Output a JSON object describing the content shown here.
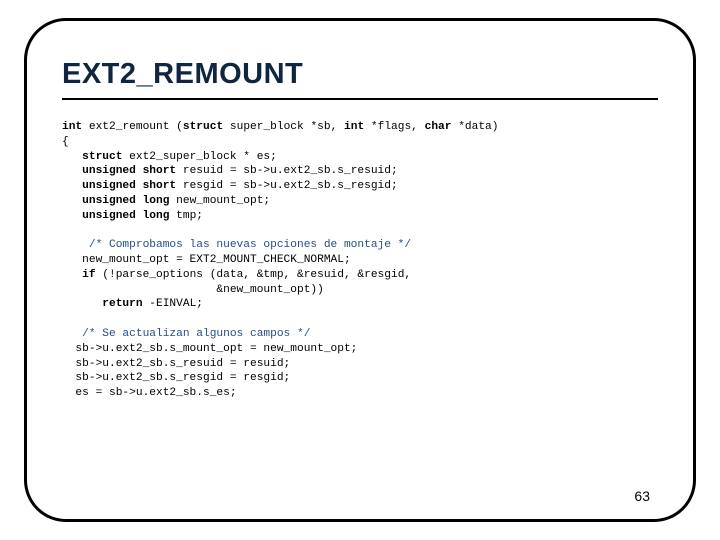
{
  "slide": {
    "title": "EXT2_REMOUNT",
    "page_number": "63",
    "code": {
      "sig_pre": "int",
      "sig_mid1": " ext2_remount (",
      "sig_kw2": "struct",
      "sig_mid2": " super_block *sb, ",
      "sig_kw3": "int",
      "sig_mid3": " *flags, ",
      "sig_kw4": "char",
      "sig_mid4": " *data)",
      "brace_open": "{",
      "l1_kw": "   struct",
      "l1_rest": " ext2_super_block * es;",
      "l2_kw": "   unsigned short",
      "l2_rest": " resuid = sb->u.ext2_sb.s_resuid;",
      "l3_kw": "   unsigned short",
      "l3_rest": " resgid = sb->u.ext2_sb.s_resgid;",
      "l4_kw": "   unsigned long",
      "l4_rest": " new_mount_opt;",
      "l5_kw": "   unsigned long",
      "l5_rest": " tmp;",
      "blank1": " ",
      "c1": "    /* Comprobamos las nuevas opciones de montaje */",
      "l6": "   new_mount_opt = EXT2_MOUNT_CHECK_NORMAL;",
      "l7_kw": "   if",
      "l7_rest": " (!parse_options (data, &tmp, &resuid, &resgid,",
      "l8": "                       &new_mount_opt))",
      "l9_kw": "      return",
      "l9_rest": " -EINVAL;",
      "blank2": " ",
      "c2": "   /* Se actualizan algunos campos */",
      "l10": "  sb->u.ext2_sb.s_mount_opt = new_mount_opt;",
      "l11": "  sb->u.ext2_sb.s_resuid = resuid;",
      "l12": "  sb->u.ext2_sb.s_resgid = resgid;",
      "l13": "  es = sb->u.ext2_sb.s_es;"
    }
  }
}
